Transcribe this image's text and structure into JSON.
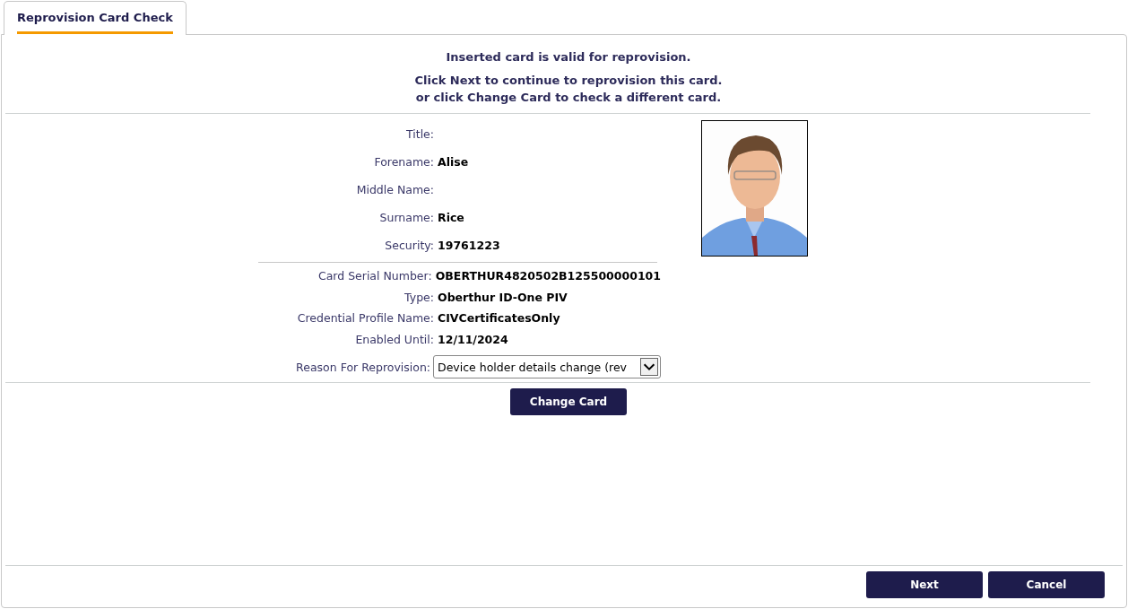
{
  "tab": {
    "label": "Reprovision Card Check",
    "selected": true
  },
  "messages": [
    "Inserted card is valid for reprovision.",
    "Click Next to continue to reprovision this card.",
    "or click Change Card to check a different card."
  ],
  "person_fields": [
    {
      "label": "Title:"
    },
    {
      "label": "Forename:",
      "value": "Alise"
    },
    {
      "label": "Middle Name:"
    },
    {
      "label": "Surname:",
      "value": "Rice"
    },
    {
      "label": "Security:",
      "value": "19761223"
    }
  ],
  "card_fields": [
    {
      "label": "Card Serial Number:",
      "value": "OBERTHUR4820502B125500000101"
    },
    {
      "label": "Type:",
      "value": "Oberthur ID-One PIV"
    },
    {
      "label": "Credential Profile Name:",
      "value": "CIVCertificatesOnly"
    },
    {
      "label": "Enabled Until:",
      "value": "12/11/2024"
    }
  ],
  "reason": {
    "label": "Reason For Reprovision:",
    "value": "Device holder details change (rev"
  },
  "change_card_button": "Change Card",
  "footer_buttons": [
    "Next",
    "Cancel"
  ]
}
